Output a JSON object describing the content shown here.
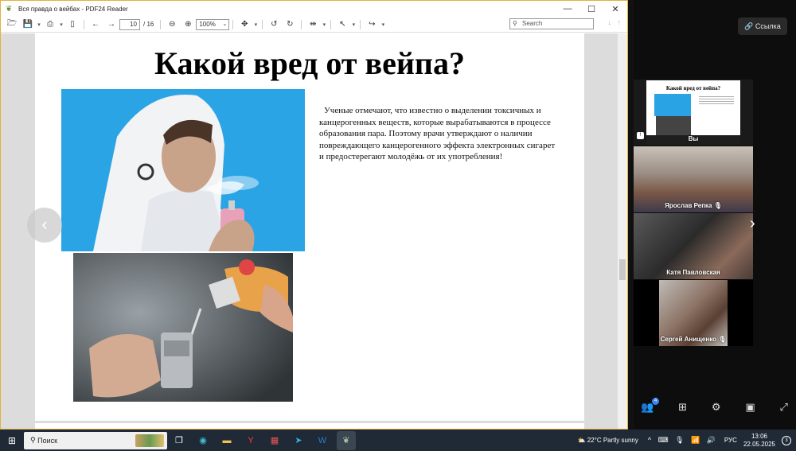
{
  "pdf_window": {
    "title": "Вся правда о вейбах - PDF24 Reader",
    "controls": {
      "minimize": "—",
      "maximize": "☐",
      "close": "✕"
    },
    "toolbar": {
      "page_current": "10",
      "page_total": "/ 16",
      "zoom": "100%",
      "search_placeholder": "Search"
    }
  },
  "slide": {
    "title": "Какой вред от вейпа?",
    "body": "Ученые отмечают, что  известно о выделении токсичных и канцерогенных веществ, которые вырабатываются в процессе образования пара. Поэтому врачи утверждают о наличии повреждающего  канцерогенного эффекта электронных сигарет и предостерегают молодёжь от их употребления!"
  },
  "call_panel": {
    "link_label": "Ссылка",
    "participants": [
      {
        "name": "Вы",
        "muted": true
      },
      {
        "name": "Ярослав Репка",
        "muted": true
      },
      {
        "name": "Катя Павловская",
        "muted": false
      },
      {
        "name": "Сергей Анищенко",
        "muted": true
      }
    ],
    "controls": [
      "participants-icon",
      "grid-icon",
      "gear-icon",
      "screen-icon",
      "fullscreen-icon"
    ],
    "participants_badge": "4"
  },
  "taskbar": {
    "search_label": "Поиск",
    "apps": [
      "task-view-icon",
      "edge-icon",
      "explorer-icon",
      "yandex-icon",
      "calendar-icon",
      "telegram-icon",
      "word-icon",
      "pdf24-icon"
    ],
    "weather": "22°C  Partly sunny",
    "language": "РУС",
    "time": "13:06",
    "date": "22.05.2025",
    "notifications": "3"
  }
}
